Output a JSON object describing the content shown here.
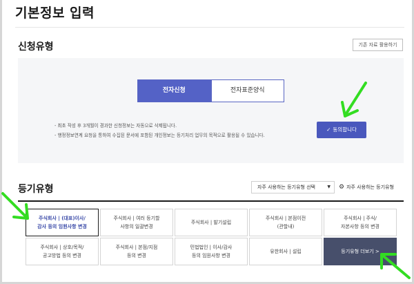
{
  "page": {
    "title": "기본정보 입력"
  },
  "application_type": {
    "section_title": "신청유형",
    "existing_button": "기존 자료 활용하기",
    "tabs": [
      {
        "label": "전자신청",
        "active": true
      },
      {
        "label": "전자표준양식",
        "active": false
      }
    ],
    "notices": [
      "- 최초 작성 후 3개월이 경과한 신청정보는 자동으로 삭제됩니다.",
      "- 행정정보연계 요청을 통하여 수집된 문서에 포함된 개인정보는 등기처리 업무의 목적으로 활용될 수 있습니다."
    ],
    "agree_button": "동의합니다",
    "agree_icon": "check-icon"
  },
  "registration_type": {
    "section_title": "등기유형",
    "frequent_select": "자주 사용하는 등기유형 선택",
    "frequent_settings": "자주 사용하는 등기유형",
    "cells": [
      {
        "label": "주식회사 | (대표)이사/\n감사 등의 임원사항 변경",
        "selected": true
      },
      {
        "label": "주식회사 | 여러 등기할\n사항의 일괄변경"
      },
      {
        "label": "주식회사 | 발기설립"
      },
      {
        "label": "주식회사 | 본점이전\n(관할내)"
      },
      {
        "label": "주식회사 | 주식/\n자본사항 등의 변경"
      },
      {
        "label": "주식회사 | 상호/목적/\n공고방법 등의 변경"
      },
      {
        "label": "주식회사 | 본점/지점\n등의 변경"
      },
      {
        "label": "민법법인 | 이사/감사\n등의 임원사항 변경"
      },
      {
        "label": "유한회사 | 설립"
      },
      {
        "label": "등기유형 더보기 >",
        "more": true
      }
    ]
  },
  "colors": {
    "accent": "#5462c6",
    "agree_bg": "#4a58bd",
    "more_bg": "#474f6b",
    "annotation_arrow": "#33dd22"
  }
}
